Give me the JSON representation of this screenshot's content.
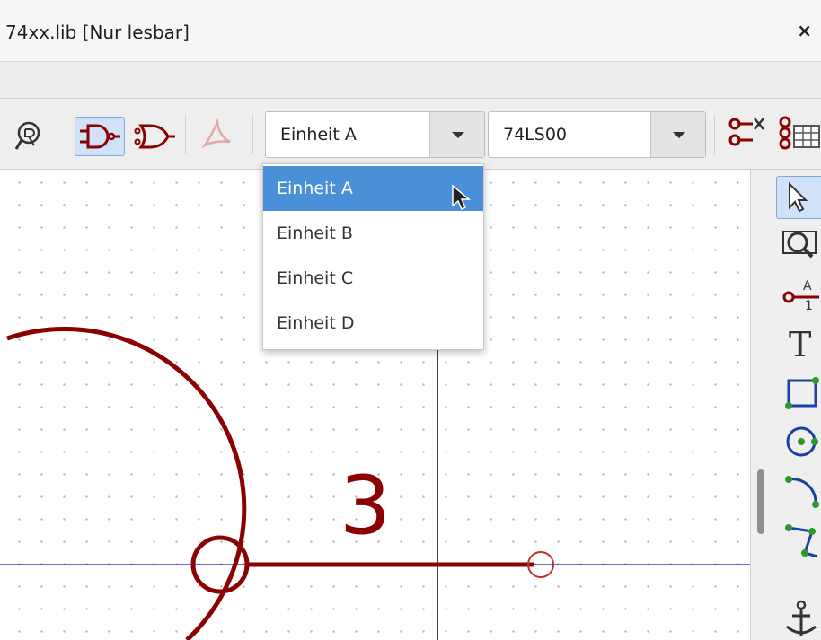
{
  "window": {
    "title": "74xx.lib [Nur lesbar]",
    "close_glyph": "×"
  },
  "toolbar": {
    "icons": [
      "zoom-fit-icon",
      "de-morgan-normal-icon",
      "de-morgan-convert-icon",
      "datasheet-pdf-icon",
      "pin-table-icon",
      "pin-table-view-icon"
    ],
    "unit_select": {
      "value": "Einheit A",
      "options": [
        "Einheit A",
        "Einheit B",
        "Einheit C",
        "Einheit D"
      ],
      "highlighted": "Einheit A"
    },
    "part_select": {
      "value": "74LS00"
    }
  },
  "right_toolbar": {
    "icons": [
      "select-arrow-icon",
      "zoom-selection-icon",
      "add-pin-icon",
      "add-text-icon",
      "add-rectangle-icon",
      "add-circle-icon",
      "add-arc-icon",
      "add-polyline-icon",
      "anchor-icon"
    ],
    "text_tool_glyph": "T",
    "pin_icon_top": "A",
    "pin_icon_bottom": "1"
  },
  "canvas": {
    "pin_number": "3"
  },
  "colors": {
    "symbol": "#8b0000",
    "axis": "#3f3fbf",
    "selection": "#4a90d9",
    "origin_axis": "#000000"
  }
}
